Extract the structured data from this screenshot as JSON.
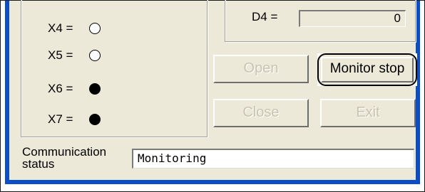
{
  "inputs": [
    {
      "label": "X4 =",
      "state": "off"
    },
    {
      "label": "X5 =",
      "state": "off"
    },
    {
      "label": "X6 =",
      "state": "on"
    },
    {
      "label": "X7 =",
      "state": "on"
    }
  ],
  "d4": {
    "label": "D4 =",
    "value": "0"
  },
  "buttons": {
    "open": "Open",
    "monitor_stop": "Monitor stop",
    "close": "Close",
    "exit": "Exit"
  },
  "status": {
    "label_line1": "Communication",
    "label_line2": "status",
    "value": "Monitoring"
  },
  "colors": {
    "window_border": "#0a4fc8",
    "face": "#ece9d8"
  }
}
